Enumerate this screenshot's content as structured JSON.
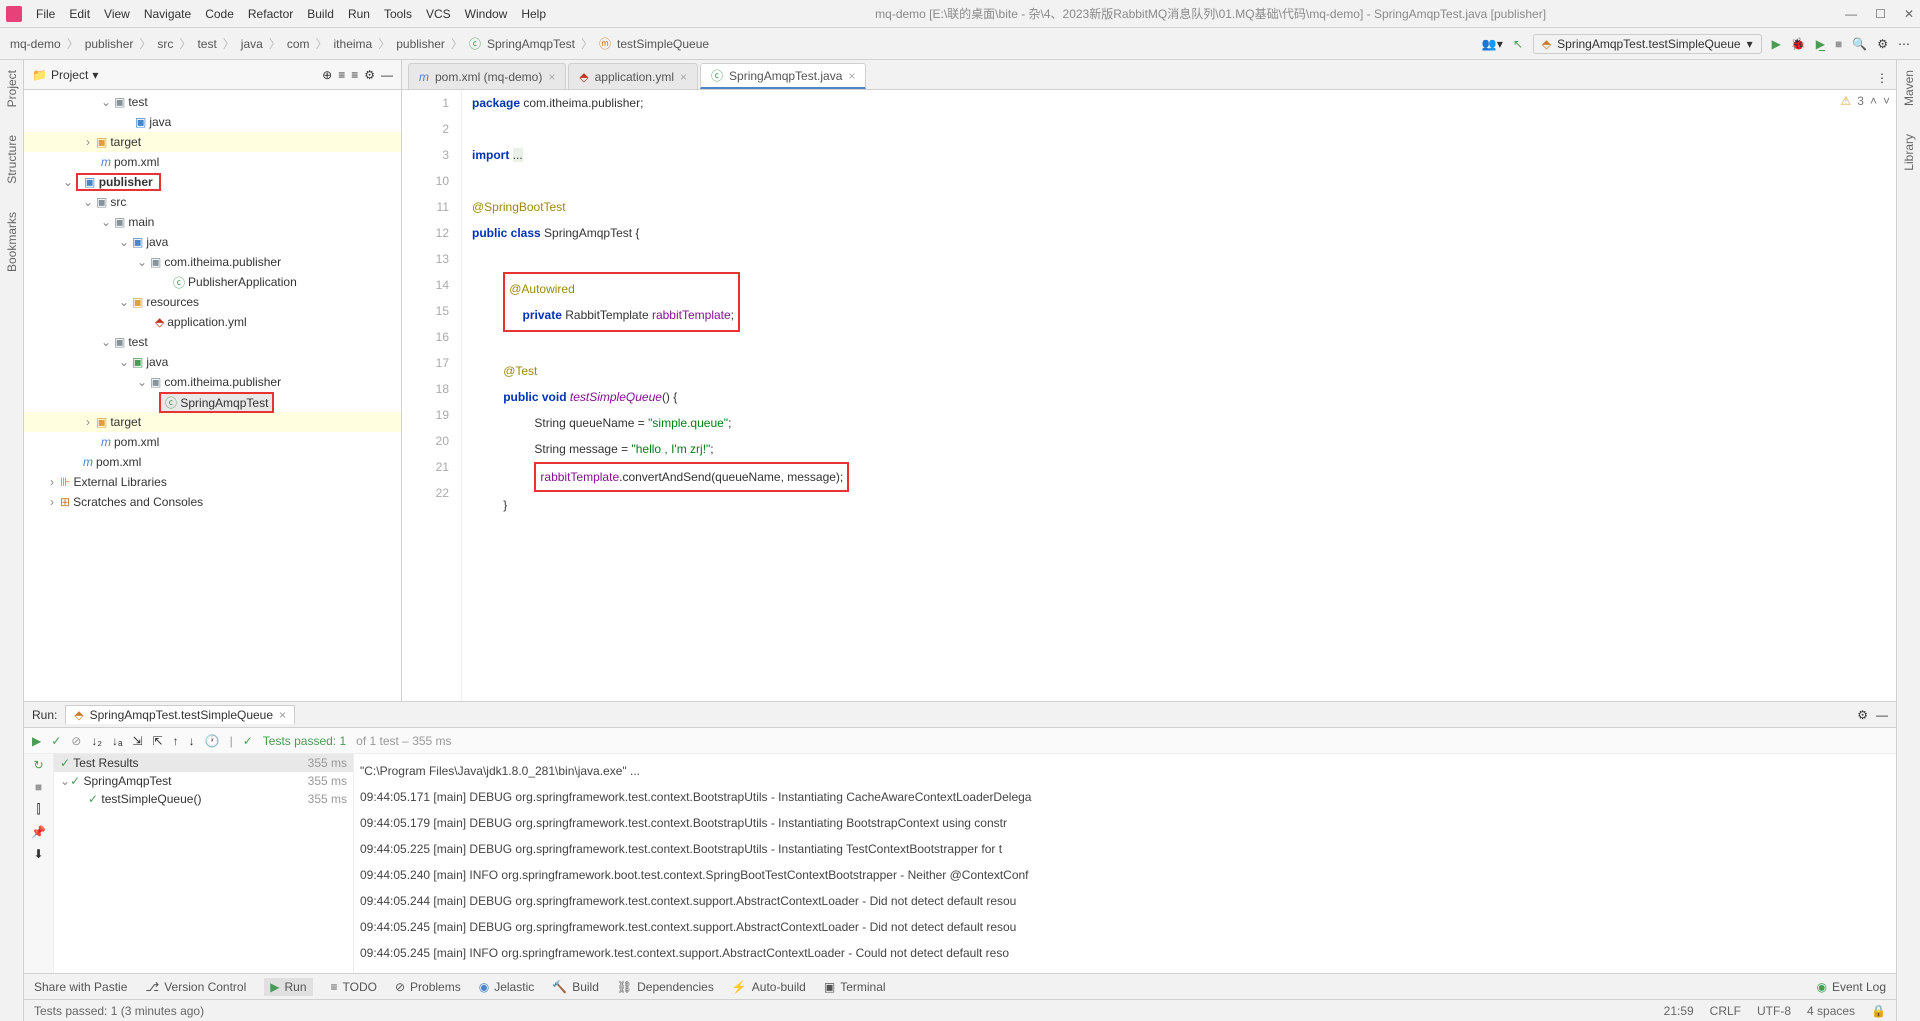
{
  "window": {
    "title": "mq-demo [E:\\联的桌面\\bite - 杂\\4、2023新版RabbitMQ消息队列\\01.MQ基础\\代码\\mq-demo] - SpringAmqpTest.java [publisher]"
  },
  "menu": [
    "File",
    "Edit",
    "View",
    "Navigate",
    "Code",
    "Refactor",
    "Build",
    "Run",
    "Tools",
    "VCS",
    "Window",
    "Help"
  ],
  "breadcrumbs": [
    "mq-demo",
    "publisher",
    "src",
    "test",
    "java",
    "com",
    "itheima",
    "publisher",
    "SpringAmqpTest",
    "testSimpleQueue"
  ],
  "runConfig": "SpringAmqpTest.testSimpleQueue",
  "leftTabs": [
    "Project",
    "Structure",
    "Bookmarks"
  ],
  "rightTabs": [
    "Maven",
    "Library"
  ],
  "projectHeader": "Project",
  "tree": {
    "n0": "test",
    "n1": "java",
    "n2": "target",
    "n3": "pom.xml",
    "n4": "publisher",
    "n5": "src",
    "n6": "main",
    "n7": "java",
    "n8": "com.itheima.publisher",
    "n9": "PublisherApplication",
    "n10": "resources",
    "n11": "application.yml",
    "n12": "test",
    "n13": "java",
    "n14": "com.itheima.publisher",
    "n15": "SpringAmqpTest",
    "n16": "target",
    "n17": "pom.xml",
    "n18": "pom.xml",
    "n19": "External Libraries",
    "n20": "Scratches and Consoles"
  },
  "editorTabs": [
    {
      "label": "pom.xml (mq-demo)",
      "icon": "m"
    },
    {
      "label": "application.yml",
      "icon": "y"
    },
    {
      "label": "SpringAmqpTest.java",
      "icon": "c",
      "active": true
    }
  ],
  "warnings": "3",
  "gutterLines": [
    "1",
    "2",
    "3",
    "10",
    "11",
    "12",
    "13",
    "14",
    "15",
    "16",
    "17",
    "18",
    "19",
    "20",
    "21",
    "22"
  ],
  "code": {
    "l1a": "package ",
    "l1b": "com.itheima.publisher;",
    "l3a": "import ",
    "l3b": "...",
    "l11": "@SpringBootTest",
    "l12a": "public class ",
    "l12b": "SpringAmqpTest {",
    "l14": "@Autowired",
    "l15a": "private ",
    "l15b": "RabbitTemplate ",
    "l15c": "rabbitTemplate",
    "l17": "@Test",
    "l18a": "public void ",
    "l18b": "testSimpleQueue",
    "l18c": "() {",
    "l19a": "String queueName = ",
    "l19b": "\"simple.queue\"",
    "l19c": ";",
    "l20a": "String message = ",
    "l20b": "\"hello , I'm zrj!\"",
    "l20c": ";",
    "l21a": "rabbitTemplate",
    "l21b": ".convertAndSend(queueName, message);",
    "l22": "}"
  },
  "run": {
    "label": "Run:",
    "tab": "SpringAmqpTest.testSimpleQueue",
    "status": "Tests passed: 1",
    "statusGray": " of 1 test – 355 ms",
    "results": "Test Results",
    "time": "355 ms",
    "tr1": "SpringAmqpTest",
    "tr1t": "355 ms",
    "tr2": "testSimpleQueue()",
    "tr2t": "355 ms"
  },
  "console": [
    "\"C:\\Program Files\\Java\\jdk1.8.0_281\\bin\\java.exe\" ...",
    "09:44:05.171 [main] DEBUG org.springframework.test.context.BootstrapUtils - Instantiating CacheAwareContextLoaderDelega",
    "09:44:05.179 [main] DEBUG org.springframework.test.context.BootstrapUtils - Instantiating BootstrapContext using constr",
    "09:44:05.225 [main] DEBUG org.springframework.test.context.BootstrapUtils - Instantiating TestContextBootstrapper for t",
    "09:44:05.240 [main] INFO org.springframework.boot.test.context.SpringBootTestContextBootstrapper - Neither @ContextConf",
    "09:44:05.244 [main] DEBUG org.springframework.test.context.support.AbstractContextLoader - Did not detect default resou",
    "09:44:05.245 [main] DEBUG org.springframework.test.context.support.AbstractContextLoader - Did not detect default resou",
    "09:44:05.245 [main] INFO org.springframework.test.context.support.AbstractContextLoader - Could not detect default reso"
  ],
  "bottomBar": {
    "pastie": "Share with Pastie",
    "vcs": "Version Control",
    "run": "Run",
    "todo": "TODO",
    "problems": "Problems",
    "jelastic": "Jelastic",
    "build": "Build",
    "deps": "Dependencies",
    "autobuild": "Auto-build",
    "terminal": "Terminal",
    "eventlog": "Event Log"
  },
  "statusBar": {
    "msg": "Tests passed: 1 (3 minutes ago)",
    "pos": "21:59",
    "crlf": "CRLF",
    "enc": "UTF-8",
    "indent": "4 spaces"
  }
}
